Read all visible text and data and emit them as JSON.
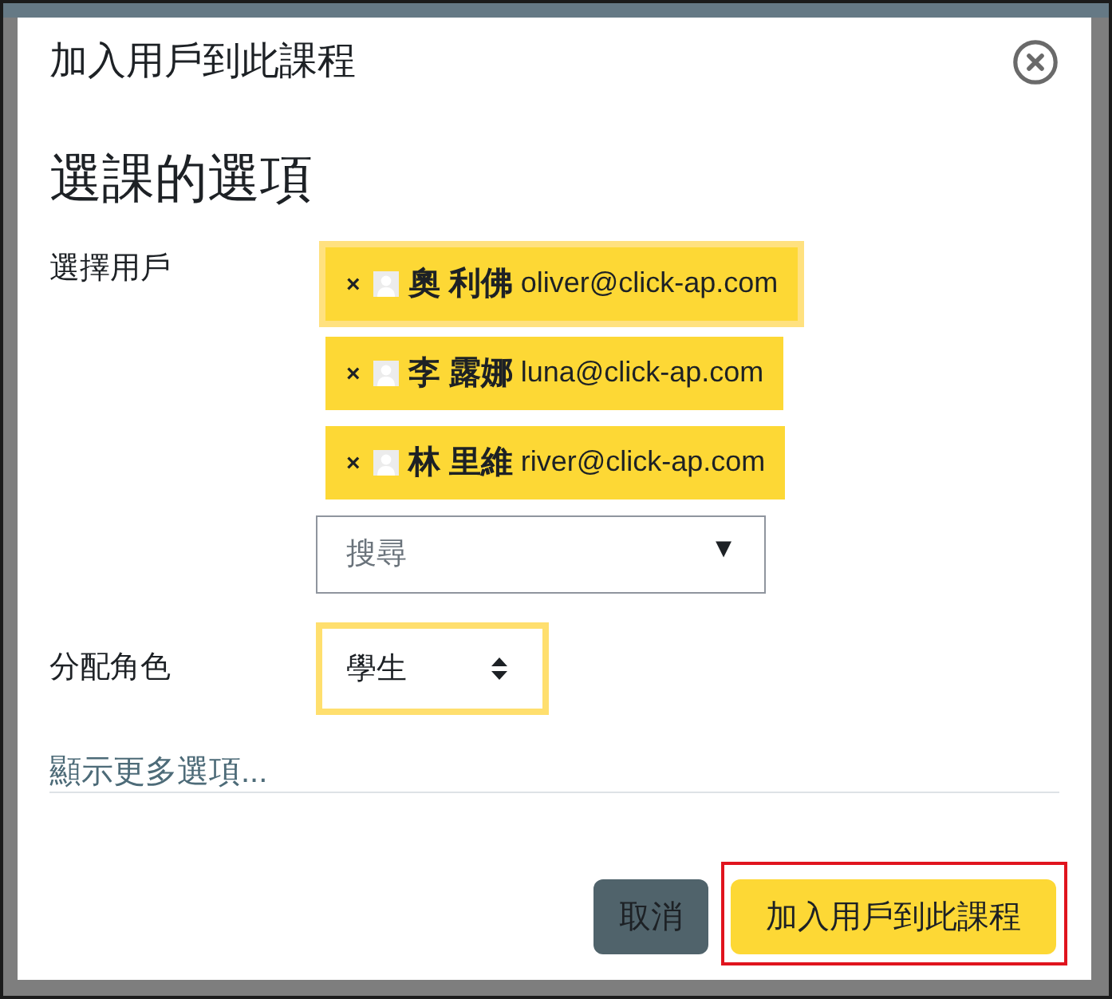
{
  "dialog": {
    "title": "加入用戶到此課程",
    "section_heading": "選課的選項",
    "user_field": {
      "label": "選擇用戶",
      "selected_users": [
        {
          "remove_label": "×",
          "name": "奧 利佛",
          "email": "oliver@click-ap.com",
          "focused": true
        },
        {
          "remove_label": "×",
          "name": "李 露娜",
          "email": "luna@click-ap.com",
          "focused": false
        },
        {
          "remove_label": "×",
          "name": "林 里維",
          "email": "river@click-ap.com",
          "focused": false
        }
      ],
      "search": {
        "placeholder": "搜尋",
        "dropdown_arrow": "▼"
      }
    },
    "role_field": {
      "label": "分配角色",
      "value": "學生",
      "focused": true
    },
    "more_options_link": "顯示更多選項...",
    "buttons": [
      {
        "kind": "secondary",
        "label": "取消",
        "highlighted": false
      },
      {
        "kind": "primary",
        "label": "加入用戶到此課程",
        "highlighted": true
      }
    ]
  }
}
